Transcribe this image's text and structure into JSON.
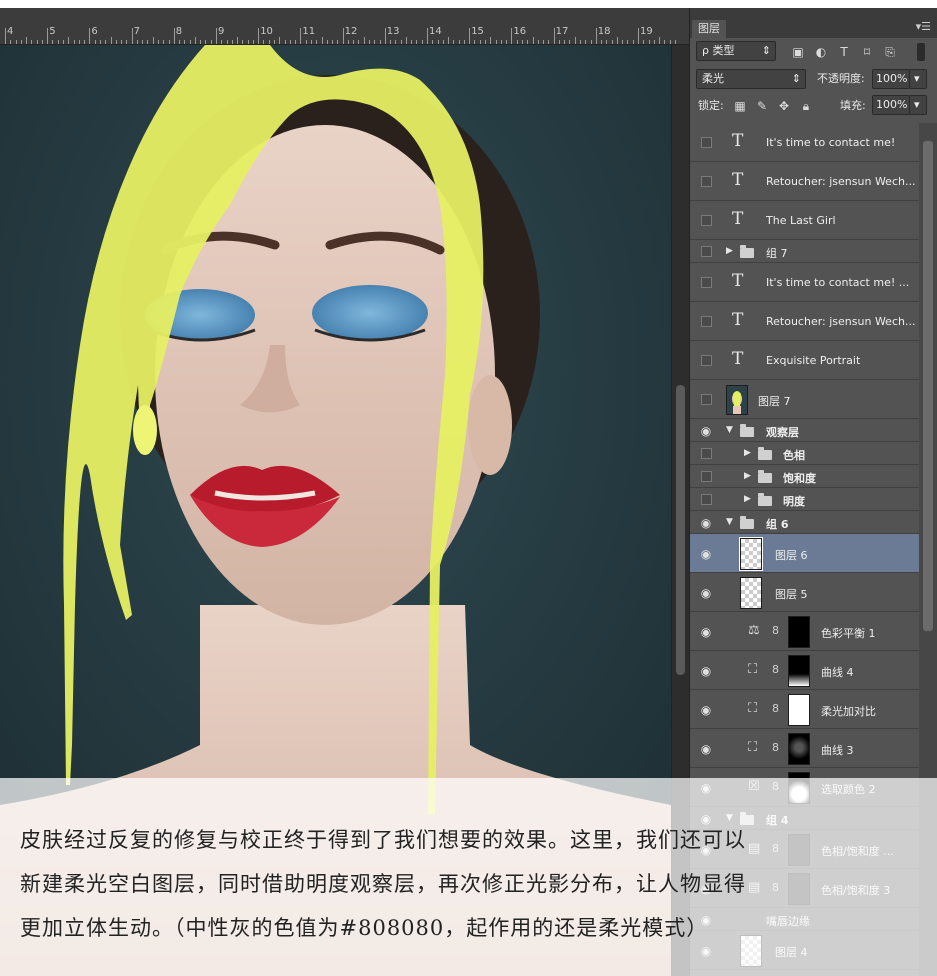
{
  "ruler": {
    "ticks": [
      "4",
      "5",
      "6",
      "7",
      "8",
      "9",
      "10",
      "11",
      "12",
      "13",
      "14",
      "15",
      "16",
      "17",
      "18",
      "19"
    ]
  },
  "panel": {
    "tab_label": "图层",
    "filter_label": "ρ 类型",
    "blend_mode": "柔光",
    "opacity_label": "不透明度:",
    "opacity_value": "100%",
    "lock_label": "锁定:",
    "fill_label": "填充:",
    "fill_value": "100%"
  },
  "layers": [
    {
      "name": "It's time to contact me!",
      "kind": "text",
      "visible": false
    },
    {
      "name": "Retoucher: jsensun Wech...",
      "kind": "text",
      "visible": false
    },
    {
      "name": "The Last Girl",
      "kind": "text",
      "visible": false
    },
    {
      "name": "组 7",
      "kind": "group-closed",
      "visible": false
    },
    {
      "name": "It's time to contact me! ...",
      "kind": "text",
      "visible": false
    },
    {
      "name": "Retoucher: jsensun Wech...",
      "kind": "text",
      "visible": false
    },
    {
      "name": "Exquisite Portrait",
      "kind": "text",
      "visible": false
    },
    {
      "name": "图层 7",
      "kind": "image",
      "visible": false
    },
    {
      "name": "观察层",
      "kind": "group-open",
      "visible": true
    },
    {
      "name": "色相",
      "kind": "subgroup",
      "visible": false
    },
    {
      "name": "饱和度",
      "kind": "subgroup",
      "visible": false
    },
    {
      "name": "明度",
      "kind": "subgroup",
      "visible": false
    },
    {
      "name": "组 6",
      "kind": "group-open",
      "visible": true
    },
    {
      "name": "图层 6",
      "kind": "pixel",
      "visible": true,
      "selected": true
    },
    {
      "name": "图层 5",
      "kind": "pixel",
      "visible": true
    },
    {
      "name": "色彩平衡 1",
      "kind": "adjust-balance",
      "visible": true
    },
    {
      "name": "曲线 4",
      "kind": "adjust-curve",
      "visible": true
    },
    {
      "name": "柔光加对比",
      "kind": "adjust-curve",
      "visible": true
    },
    {
      "name": "曲线 3",
      "kind": "adjust-curve",
      "visible": true
    },
    {
      "name": "选取颜色 2",
      "kind": "adjust-select",
      "visible": true
    },
    {
      "name": "组 4",
      "kind": "group-open",
      "visible": true
    },
    {
      "name": "色相/饱和度 ...",
      "kind": "adjust-hue",
      "visible": true
    },
    {
      "name": "色相/饱和度 3",
      "kind": "adjust-hue",
      "visible": true
    },
    {
      "name": "嘴唇边缘",
      "kind": "group-text",
      "visible": true
    },
    {
      "name": "图层 4",
      "kind": "pixel",
      "visible": true
    }
  ],
  "caption": {
    "line1": "皮肤经过反复的修复与校正终于得到了我们想要的效果。这里，我们还可以",
    "line2": "新建柔光空白图层，同时借助明度观察层，再次修正光影分布，让人物显得",
    "line3": "更加立体生动。（中性灰的色值为#808080，起作用的还是柔光模式）"
  }
}
